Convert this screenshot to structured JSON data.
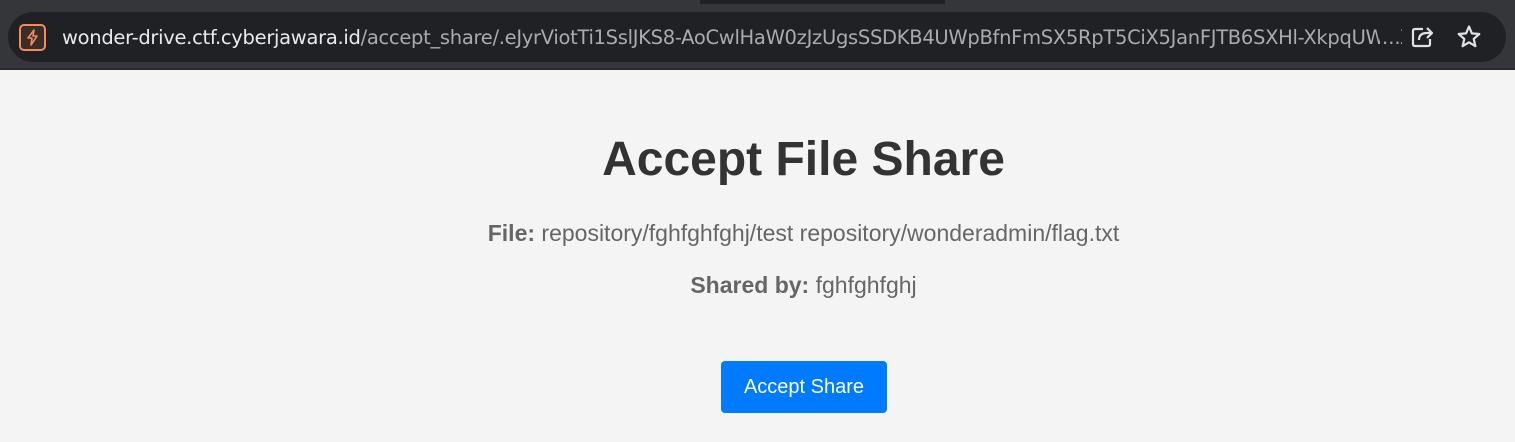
{
  "browser": {
    "url_host": "wonder-drive.ctf.cyberjawara.id",
    "url_path": "/accept_share/.eJyrViotTi1SslJKS8-AoCwlHaW0zJzUgsSSDKB4UWpBfnFmSX5RpT5CiX5JanFJTB6SXHl-XkpqUWJK",
    "url_ellipsis": "...",
    "icons": {
      "site": "site-security-icon",
      "share": "share-icon",
      "bookmark": "star-icon"
    },
    "colors": {
      "chrome": "#35363a",
      "omnibox": "#202124",
      "site_icon_accent": "#f28b62"
    }
  },
  "page": {
    "title": "Accept File Share",
    "file_label": "File:",
    "file_value": "repository/fghfghfghj/test repository/wonderadmin/flag.txt",
    "shared_label": "Shared by:",
    "shared_value": "fghfghfghj",
    "accept_button": "Accept Share",
    "colors": {
      "background": "#f4f4f4",
      "button": "#007bff",
      "title": "#333333",
      "text": "#666666"
    }
  }
}
